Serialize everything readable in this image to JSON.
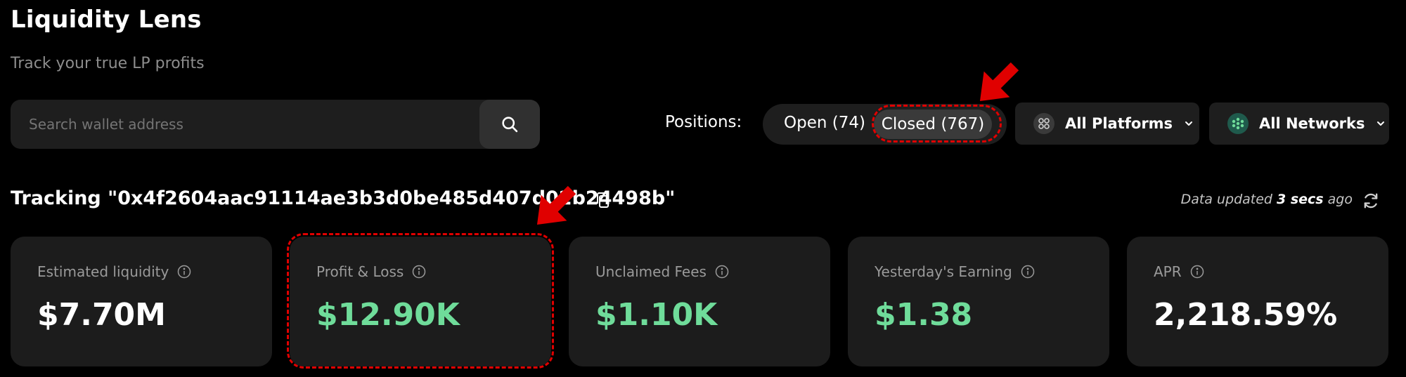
{
  "app": {
    "title": "Liquidity Lens",
    "subtitle": "Track your true LP profits"
  },
  "search": {
    "placeholder": "Search wallet address",
    "icon": "search-icon"
  },
  "positions": {
    "label": "Positions:",
    "open_label": "Open (74)",
    "closed_label": "Closed (767)",
    "selected": "Closed (767)"
  },
  "filters": {
    "platforms_label": "All Platforms",
    "networks_label": "All Networks"
  },
  "tracking": {
    "text": "Tracking \"0x4f2604aac91114ae3b3d0be485d407d02b24498b\""
  },
  "status": {
    "prefix": "Data updated ",
    "time": "3 secs",
    "suffix": " ago"
  },
  "stats": [
    {
      "label": "Estimated liquidity",
      "value": "$7.70M",
      "color": "#ffffff"
    },
    {
      "label": "Profit & Loss",
      "value": "$12.90K",
      "color": "#6fdc9a"
    },
    {
      "label": "Unclaimed Fees",
      "value": "$1.10K",
      "color": "#6fdc9a"
    },
    {
      "label": "Yesterday's Earning",
      "value": "$1.38",
      "color": "#6fdc9a"
    },
    {
      "label": "APR",
      "value": "2,218.59%",
      "color": "#ffffff"
    }
  ],
  "colors": {
    "background": "#000000",
    "card": "#1c1c1c",
    "positive": "#6fdc9a",
    "annotation": "#e00000"
  }
}
